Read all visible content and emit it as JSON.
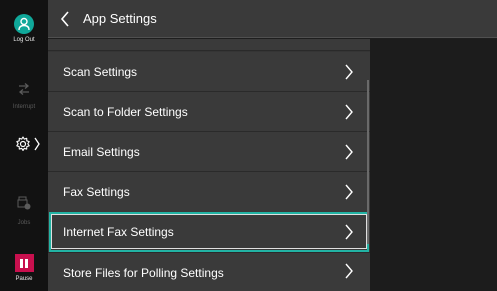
{
  "sidebar": {
    "logout_label": "Log Out",
    "interrupt_label": "Interrupt",
    "jobs_label": "Jobs",
    "pause_label": "Pause"
  },
  "header": {
    "title": "App Settings"
  },
  "menu": {
    "items": [
      {
        "label": "Scan Settings"
      },
      {
        "label": "Scan to Folder Settings"
      },
      {
        "label": "Email Settings"
      },
      {
        "label": "Fax Settings"
      },
      {
        "label": "Internet Fax Settings"
      },
      {
        "label": "Store Files for Polling Settings"
      }
    ],
    "selected_index": 4
  },
  "colors": {
    "accent": "#22b3a4",
    "logout_circle": "#10a89a",
    "pause_button": "#c8104e"
  },
  "icons": [
    "user-icon",
    "interrupt-icon",
    "gear-icon",
    "jobs-icon",
    "pause-icon",
    "back-chevron-icon",
    "chevron-right-icon"
  ]
}
